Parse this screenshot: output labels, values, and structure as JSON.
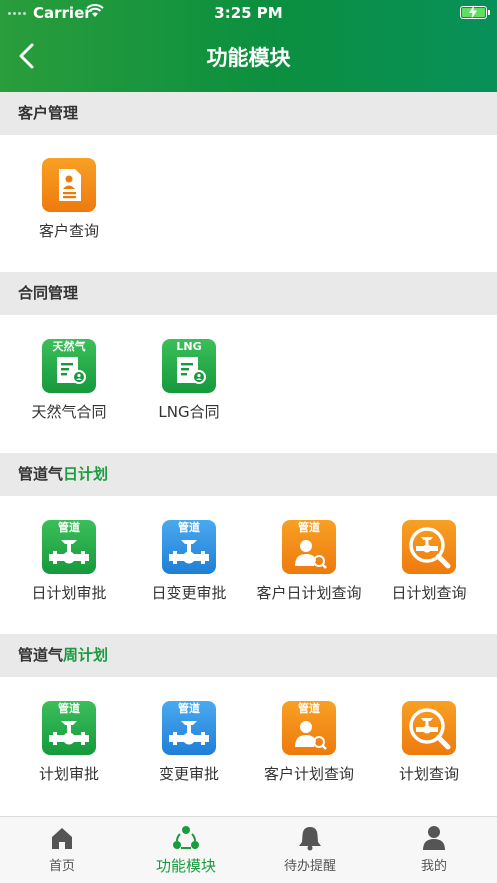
{
  "status": {
    "carrier": "Carrier",
    "time": "3:25 PM"
  },
  "nav": {
    "title": "功能模块"
  },
  "sections": {
    "customer": {
      "title": "客户管理",
      "items": [
        {
          "label": "客户查询",
          "icon": "customer-profile-icon"
        }
      ]
    },
    "contract": {
      "title": "合同管理",
      "items": [
        {
          "label": "天然气合同",
          "tag": "天然气",
          "icon": "natural-gas-contract-icon"
        },
        {
          "label": "LNG合同",
          "tag": "LNG",
          "icon": "lng-contract-icon"
        }
      ]
    },
    "daily": {
      "title_prefix": "管道气",
      "title_highlight": "日计划",
      "items": [
        {
          "label": "日计划审批",
          "tag": "管道",
          "icon": "pipeline-valve-icon"
        },
        {
          "label": "日变更审批",
          "tag": "管道",
          "icon": "pipeline-valve-icon"
        },
        {
          "label": "客户日计划查询",
          "tag": "管道",
          "icon": "customer-search-icon"
        },
        {
          "label": "日计划查询",
          "icon": "magnifier-valve-icon"
        }
      ]
    },
    "weekly": {
      "title_prefix": "管道气",
      "title_highlight": "周计划",
      "items": [
        {
          "label": "计划审批",
          "tag": "管道",
          "icon": "pipeline-valve-icon"
        },
        {
          "label": "变更审批",
          "tag": "管道",
          "icon": "pipeline-valve-icon"
        },
        {
          "label": "客户计划查询",
          "tag": "管道",
          "icon": "customer-search-icon"
        },
        {
          "label": "计划查询",
          "icon": "magnifier-valve-icon"
        }
      ]
    }
  },
  "tabs": [
    {
      "label": "首页",
      "icon": "home-icon"
    },
    {
      "label": "功能模块",
      "icon": "modules-icon",
      "active": true
    },
    {
      "label": "待办提醒",
      "icon": "bell-icon"
    },
    {
      "label": "我的",
      "icon": "user-icon"
    }
  ],
  "colors": {
    "brand_green": "#1a9c3e",
    "icon_green": "#16993c",
    "icon_blue": "#1f7fd6",
    "icon_orange": "#ee7a0e"
  }
}
